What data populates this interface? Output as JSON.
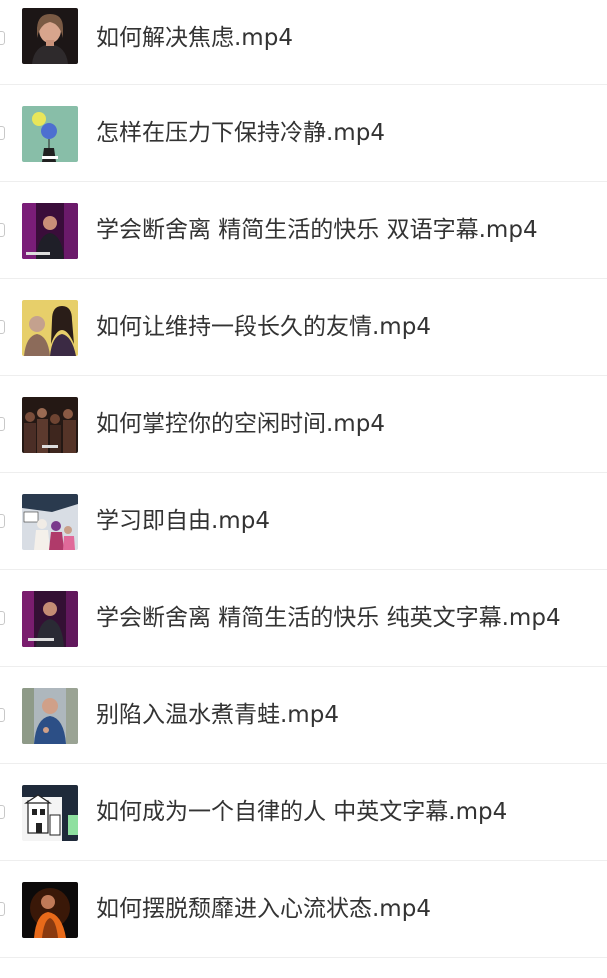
{
  "file_list": {
    "items": [
      {
        "name": "如何解决焦虑.mp4",
        "thumbnail": "woman-portrait-dark-background"
      },
      {
        "name": "怎样在压力下保持冷静.mp4",
        "thumbnail": "cartoon-balloon-character"
      },
      {
        "name": "学会断舍离 精简生活的快乐 双语字幕.mp4",
        "thumbnail": "speaker-on-purple-stage"
      },
      {
        "name": "如何让维持一段长久的友情.mp4",
        "thumbnail": "two-women-yellow-background"
      },
      {
        "name": "如何掌控你的空闲时间.mp4",
        "thumbnail": "crowd-scene-dark"
      },
      {
        "name": "学习即自由.mp4",
        "thumbnail": "women-with-headscarves-and-sign"
      },
      {
        "name": "学会断舍离 精简生活的快乐 纯英文字幕.mp4",
        "thumbnail": "speaker-on-purple-stage"
      },
      {
        "name": "别陷入温水煮青蛙.mp4",
        "thumbnail": "man-outdoors-talking"
      },
      {
        "name": "如何成为一个自律的人 中英文字幕.mp4",
        "thumbnail": "building-illustration"
      },
      {
        "name": "如何摆脱颓靡进入心流状态.mp4",
        "thumbnail": "speaker-orange-light-dark"
      }
    ]
  }
}
